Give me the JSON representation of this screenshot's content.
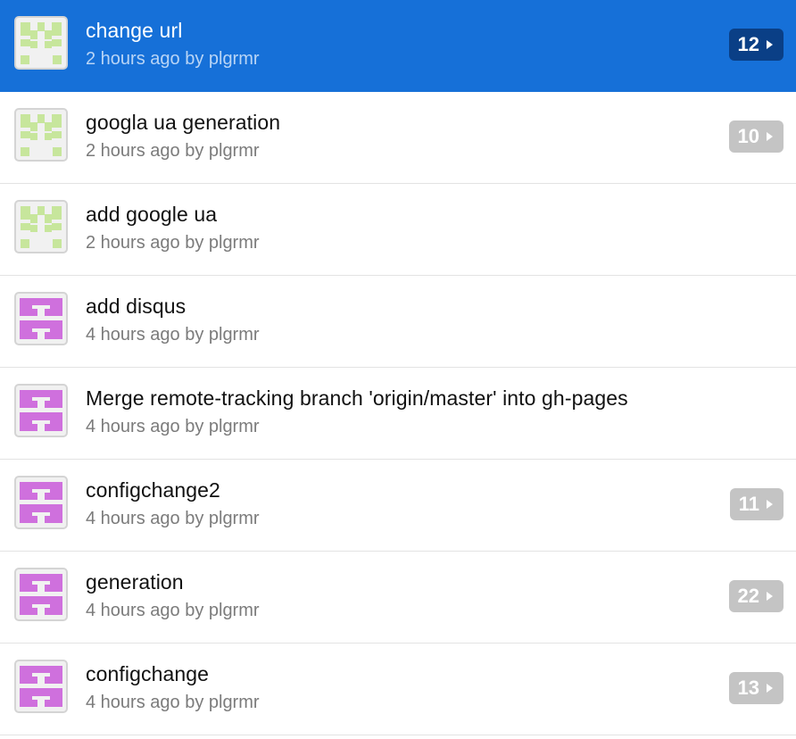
{
  "colors": {
    "selected_bg": "#1670d8",
    "badge_bg": "#c4c4c4",
    "selected_badge_bg": "#0a3f86",
    "avatar_green": "#c7e69c",
    "avatar_purple": "#cf70dd"
  },
  "commits": [
    {
      "title": "change url",
      "meta": "2 hours ago by plgrmr",
      "count": "12",
      "avatar": "identicon-green",
      "selected": true
    },
    {
      "title": "googla ua generation",
      "meta": "2 hours ago by plgrmr",
      "count": "10",
      "avatar": "identicon-green",
      "selected": false
    },
    {
      "title": "add google ua",
      "meta": "2 hours ago by plgrmr",
      "count": null,
      "avatar": "identicon-green",
      "selected": false
    },
    {
      "title": "add disqus",
      "meta": "4 hours ago by plgrmr",
      "count": null,
      "avatar": "identicon-purple",
      "selected": false
    },
    {
      "title": "Merge remote-tracking branch 'origin/master' into gh-pages",
      "meta": "4 hours ago by plgrmr",
      "count": null,
      "avatar": "identicon-purple",
      "selected": false
    },
    {
      "title": "configchange2",
      "meta": "4 hours ago by plgrmr",
      "count": "11",
      "avatar": "identicon-purple",
      "selected": false
    },
    {
      "title": "generation",
      "meta": "4 hours ago by plgrmr",
      "count": "22",
      "avatar": "identicon-purple",
      "selected": false
    },
    {
      "title": "configchange",
      "meta": "4 hours ago by plgrmr",
      "count": "13",
      "avatar": "identicon-purple",
      "selected": false
    }
  ]
}
